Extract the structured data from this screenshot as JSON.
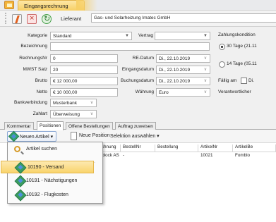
{
  "window": {
    "title_tab": "Eingangsrechnung"
  },
  "toolbar": {
    "lieferant_label": "Lieferant",
    "lieferant_value": "Gas- und Solarheizung Imatec GmbH"
  },
  "form": {
    "kategorie": {
      "label": "Kategorie",
      "value": "Standard"
    },
    "vertrag": {
      "label": "Vertrag",
      "value": ""
    },
    "bezeichnung": {
      "label": "Bezeichnung",
      "value": ""
    },
    "rechnungsnr": {
      "label": "RechnungsNr",
      "value": "0"
    },
    "re_datum": {
      "label": "RE-Datum",
      "value": "Di., 22.10.2019"
    },
    "mwst_satz": {
      "label": "MWST Satz",
      "value": "20"
    },
    "eingangsdatum": {
      "label": "Eingangsdatum",
      "value": "Di., 22.10.2019"
    },
    "brutto": {
      "label": "Brutto",
      "value": "€ 12 000,00"
    },
    "buchungsdatum": {
      "label": "Buchungsdatum",
      "value": "Di., 22.10.2019"
    },
    "netto": {
      "label": "Netto",
      "value": "€ 10 000,00"
    },
    "waehrung": {
      "label": "Währung",
      "value": "Euro"
    },
    "bankverbindung": {
      "label": "Bankverbindung",
      "value": "Musterbank"
    },
    "zahlart": {
      "label": "Zahlart",
      "value": "Überweisung"
    },
    "zahlungskonditionen_label": "Zahlungskondition",
    "kondition_30": "30 Tage (21.11",
    "kondition_14": "14 Tage (05.11",
    "faellig_label": "Fällig am",
    "faellig_value": "Di.",
    "verantwortlicher_label": "Verantwortlicher"
  },
  "tabs": [
    "Kommentar",
    "Positionen",
    "Offene Bestellungen",
    "Auftrag zuweisen"
  ],
  "positions_toolbar": {
    "neuer_artikel": "Neuen Artikel ▾",
    "neue_position": "Neue Position",
    "selektion": "Selektion auswählen ▾"
  },
  "grid": {
    "headers": [
      "eichnung",
      "BestellNr",
      "Bestellung",
      "ArtikelNr",
      "ArtikelBe"
    ],
    "rows": [
      [
        "mblock AS",
        "-",
        "",
        "10021",
        "Fomblo"
      ]
    ]
  },
  "menu": {
    "items": [
      "Artikel suchen",
      "10190 - Versand",
      "10191 - Nächstigungen",
      "10192 - Flugkosten"
    ]
  },
  "icons": {
    "title": "invoice-icon",
    "new": "new-document-icon",
    "delete": "delete-icon",
    "refresh": "refresh-icon",
    "article": "article-icon",
    "search": "search-icon"
  },
  "colors": {
    "highlight": "#f9d46c",
    "tab_accent": "#f7cf65"
  }
}
